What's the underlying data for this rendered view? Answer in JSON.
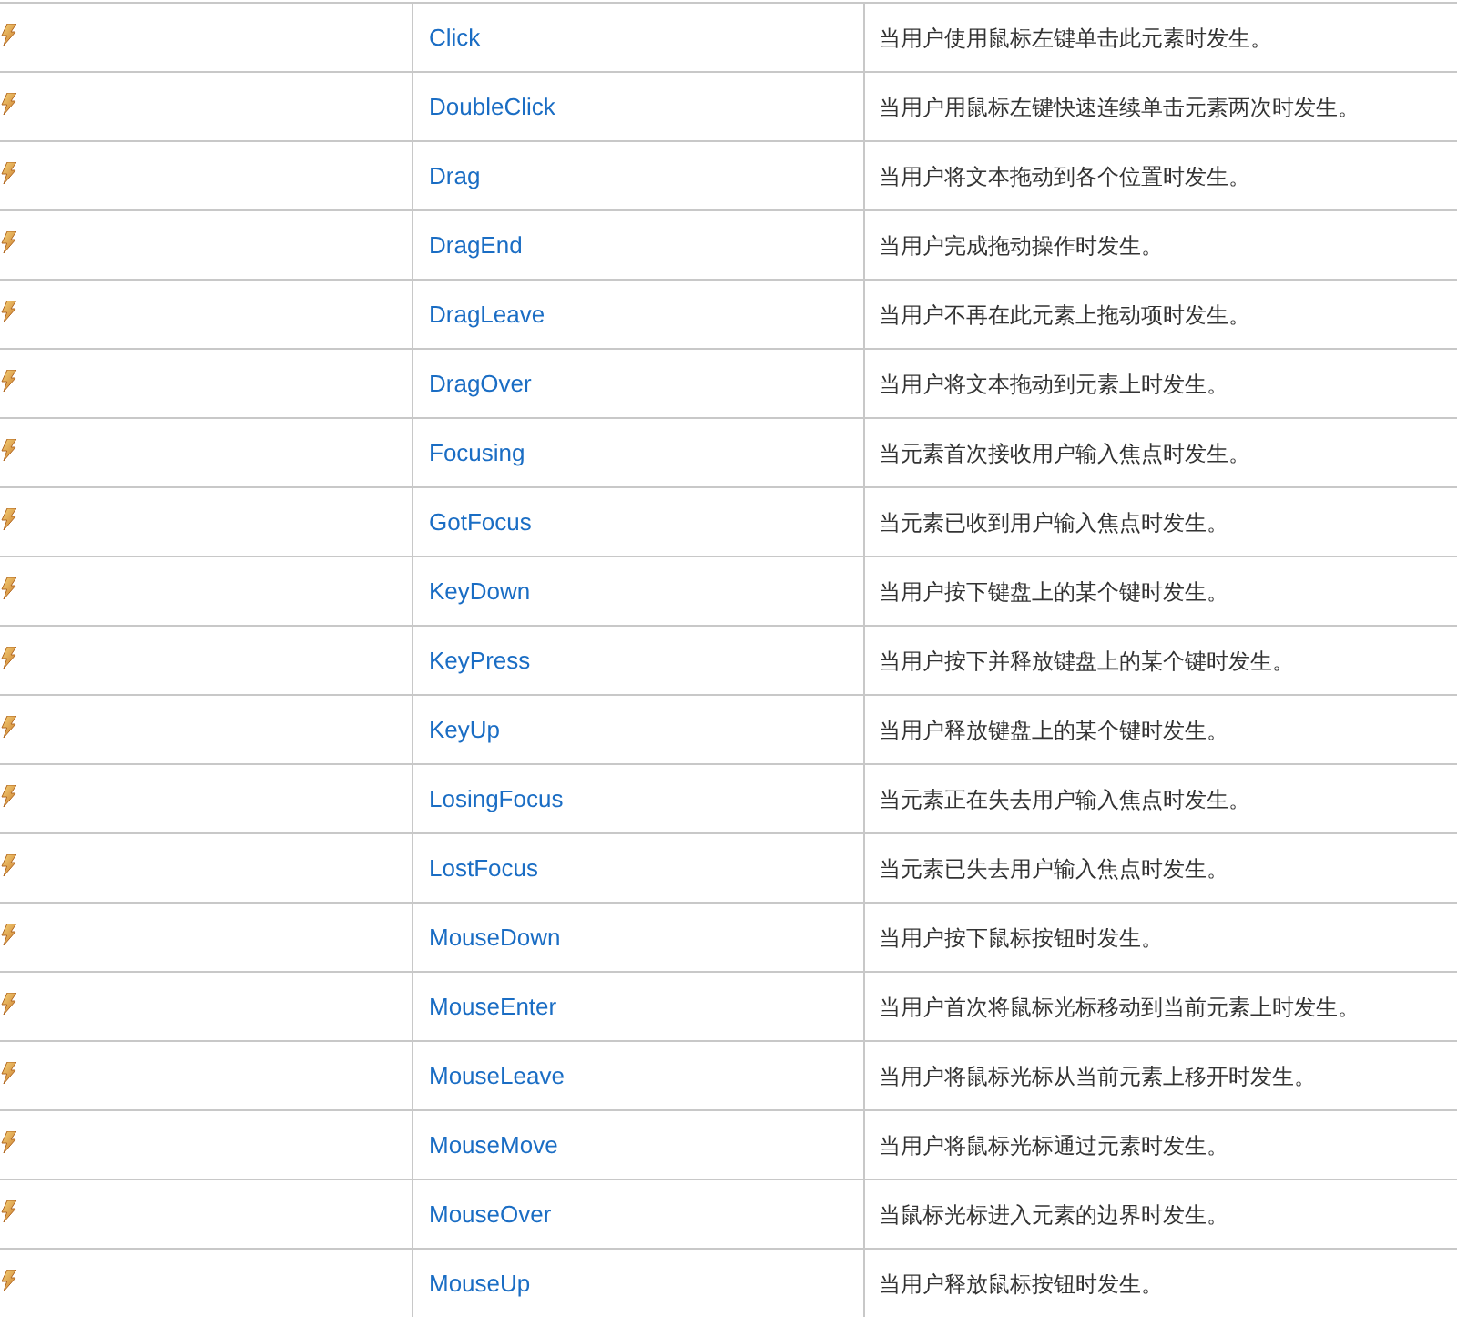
{
  "events": [
    {
      "name": "Click",
      "description": "当用户使用鼠标左键单击此元素时发生。"
    },
    {
      "name": "DoubleClick",
      "description": "当用户用鼠标左键快速连续单击元素两次时发生。"
    },
    {
      "name": "Drag",
      "description": "当用户将文本拖动到各个位置时发生。"
    },
    {
      "name": "DragEnd",
      "description": "当用户完成拖动操作时发生。"
    },
    {
      "name": "DragLeave",
      "description": "当用户不再在此元素上拖动项时发生。"
    },
    {
      "name": "DragOver",
      "description": "当用户将文本拖动到元素上时发生。"
    },
    {
      "name": "Focusing",
      "description": "当元素首次接收用户输入焦点时发生。"
    },
    {
      "name": "GotFocus",
      "description": "当元素已收到用户输入焦点时发生。"
    },
    {
      "name": "KeyDown",
      "description": "当用户按下键盘上的某个键时发生。"
    },
    {
      "name": "KeyPress",
      "description": "当用户按下并释放键盘上的某个键时发生。"
    },
    {
      "name": "KeyUp",
      "description": "当用户释放键盘上的某个键时发生。"
    },
    {
      "name": "LosingFocus",
      "description": "当元素正在失去用户输入焦点时发生。"
    },
    {
      "name": "LostFocus",
      "description": "当元素已失去用户输入焦点时发生。"
    },
    {
      "name": "MouseDown",
      "description": "当用户按下鼠标按钮时发生。"
    },
    {
      "name": "MouseEnter",
      "description": "当用户首次将鼠标光标移动到当前元素上时发生。"
    },
    {
      "name": "MouseLeave",
      "description": "当用户将鼠标光标从当前元素上移开时发生。"
    },
    {
      "name": "MouseMove",
      "description": "当用户将鼠标光标通过元素时发生。"
    },
    {
      "name": "MouseOver",
      "description": "当鼠标光标进入元素的边界时发生。"
    },
    {
      "name": "MouseUp",
      "description": "当用户释放鼠标按钮时发生。"
    }
  ]
}
